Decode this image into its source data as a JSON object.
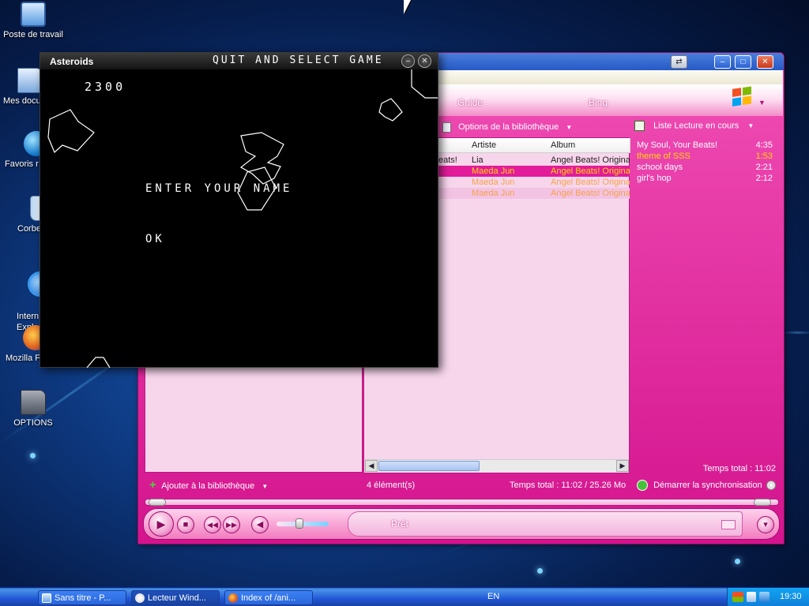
{
  "desktop": {
    "icons": [
      {
        "label": "Poste de travail",
        "icon": "computer-icon"
      },
      {
        "label": "Mes docu",
        "icon": "folder-icon"
      },
      {
        "label": "Favoris r",
        "icon": "globe-icon"
      },
      {
        "label": "Corbe",
        "icon": "recycle-bin-icon"
      },
      {
        "label": "Intern\nExplo",
        "icon": "internet-explorer-icon"
      },
      {
        "label": "Mozilla F",
        "icon": "firefox-icon"
      },
      {
        "label": "OPTIONS",
        "icon": "folder-icon"
      }
    ]
  },
  "asteroids": {
    "title": "Asteroids",
    "quit_label": "QUIT AND SELECT GAME",
    "score": "2300",
    "prompt": "ENTER YOUR NAME",
    "ok_label": "OK"
  },
  "wmp": {
    "tabs": {
      "guide": "Guide",
      "bing": "Bing"
    },
    "library_options": "Options de la bibliothèque",
    "now_playing_list": "Liste Lecture en cours",
    "columns": {
      "artist": "Artiste",
      "album": "Album"
    },
    "tracks": [
      {
        "title": "eats!",
        "artist": "Lia",
        "album": "Angel Beats! Original"
      },
      {
        "title": "",
        "artist": "Maeda Jun",
        "album": "Angel Beats! Original"
      },
      {
        "title": "",
        "artist": "Maeda Jun",
        "album": "Angel Beats! Original"
      },
      {
        "title": "",
        "artist": "Maeda Jun",
        "album": "Angel Beats! Original"
      }
    ],
    "playlist": [
      {
        "title": "My Soul, Your Beats!",
        "duration": "4:35"
      },
      {
        "title": "theme of SSS",
        "duration": "1:53"
      },
      {
        "title": "school days",
        "duration": "2:21"
      },
      {
        "title": "girl's hop",
        "duration": "2:12"
      }
    ],
    "total_time_right": "Temps total : 11:02",
    "add_to_library": "Ajouter à la bibliothèque",
    "item_count": "4 élément(s)",
    "total_time_mid": "Temps total : 11:02 / 25.26 Mo",
    "start_sync": "Démarrer la synchronisation",
    "status": "Prêt",
    "colors": {
      "accent": "#e21c9a",
      "selected_row": "#e21c9a",
      "playing_text": "#ffd700"
    }
  },
  "taskbar": {
    "buttons": [
      {
        "label": "Sans titre - P...",
        "icon": "paint-icon"
      },
      {
        "label": "Lecteur Wind...",
        "icon": "media-player-icon"
      },
      {
        "label": "Index of /ani...",
        "icon": "firefox-icon"
      }
    ],
    "language": "EN",
    "clock": "19:30"
  }
}
